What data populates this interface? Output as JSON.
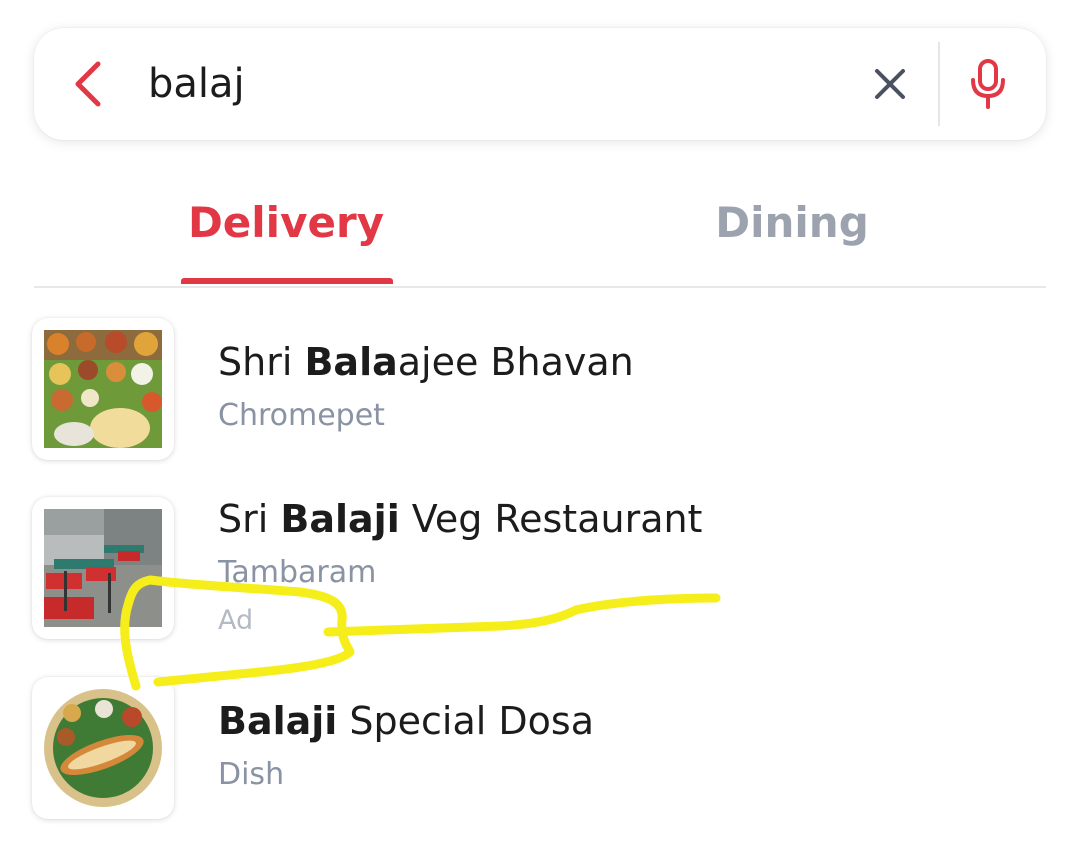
{
  "search": {
    "value": "balaj"
  },
  "tabs": [
    {
      "label": "Delivery",
      "active": true
    },
    {
      "label": "Dining",
      "active": false
    }
  ],
  "results": [
    {
      "title_pre": "Shri ",
      "title_match": "Bala",
      "title_post": "ajee Bhavan",
      "subtitle": "Chromepet",
      "ad": ""
    },
    {
      "title_pre": "Sri ",
      "title_match": "Balaji",
      "title_post": " Veg Restaurant",
      "subtitle": "Tambaram",
      "ad": "Ad"
    },
    {
      "title_pre": "",
      "title_match": "Balaji",
      "title_post": " Special Dosa",
      "subtitle": "Dish",
      "ad": ""
    }
  ],
  "icons": {
    "back": "chevron-left-icon",
    "clear": "close-icon",
    "mic": "microphone-icon"
  },
  "colors": {
    "accent": "#e23744",
    "inactive_tab": "#9ca3af",
    "subtitle": "#8a93a3",
    "annotation": "#f5ee1a"
  }
}
